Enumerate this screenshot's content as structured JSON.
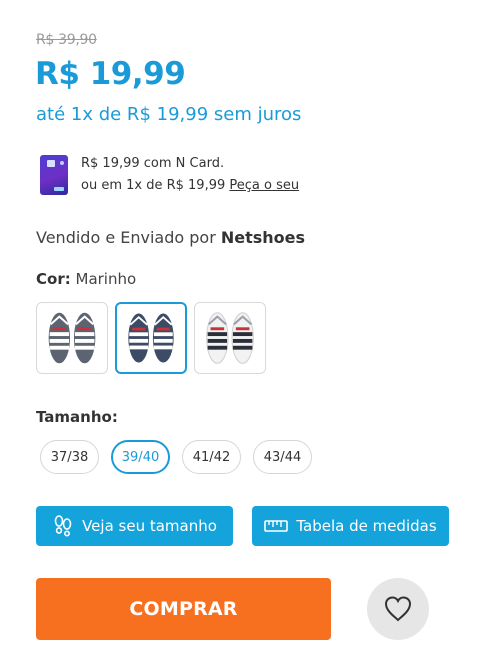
{
  "pricing": {
    "old_price": "R$ 39,90",
    "price": "R$ 19,99",
    "installments": "até 1x de R$ 19,99 sem juros"
  },
  "ncard": {
    "line1": "R$ 19,99 com N Card.",
    "line2_prefix": "ou em 1x de R$ 19,99 ",
    "link": "Peça o seu"
  },
  "seller": {
    "prefix": "Vendido e Enviado por ",
    "name": "Netshoes"
  },
  "color": {
    "label": "Cor:",
    "selected": "Marinho",
    "options": [
      {
        "name": "gray-white-red",
        "strap": "#ffffff",
        "sole": "#5b6470"
      },
      {
        "name": "navy",
        "strap": "#ffffff",
        "sole": "#3c4b66"
      },
      {
        "name": "white",
        "strap": "#2b2f3a",
        "sole": "#f2f2f2"
      }
    ]
  },
  "size": {
    "label": "Tamanho:",
    "options": [
      "37/38",
      "39/40",
      "41/42",
      "43/44"
    ],
    "selected": "39/40"
  },
  "actions": {
    "size_help": "Veja seu tamanho",
    "measure_table": "Tabela de medidas",
    "buy": "COMPRAR"
  },
  "colors": {
    "accent": "#1a9bd8",
    "buy": "#f7701f",
    "fav_bg": "#e6e6e6"
  }
}
